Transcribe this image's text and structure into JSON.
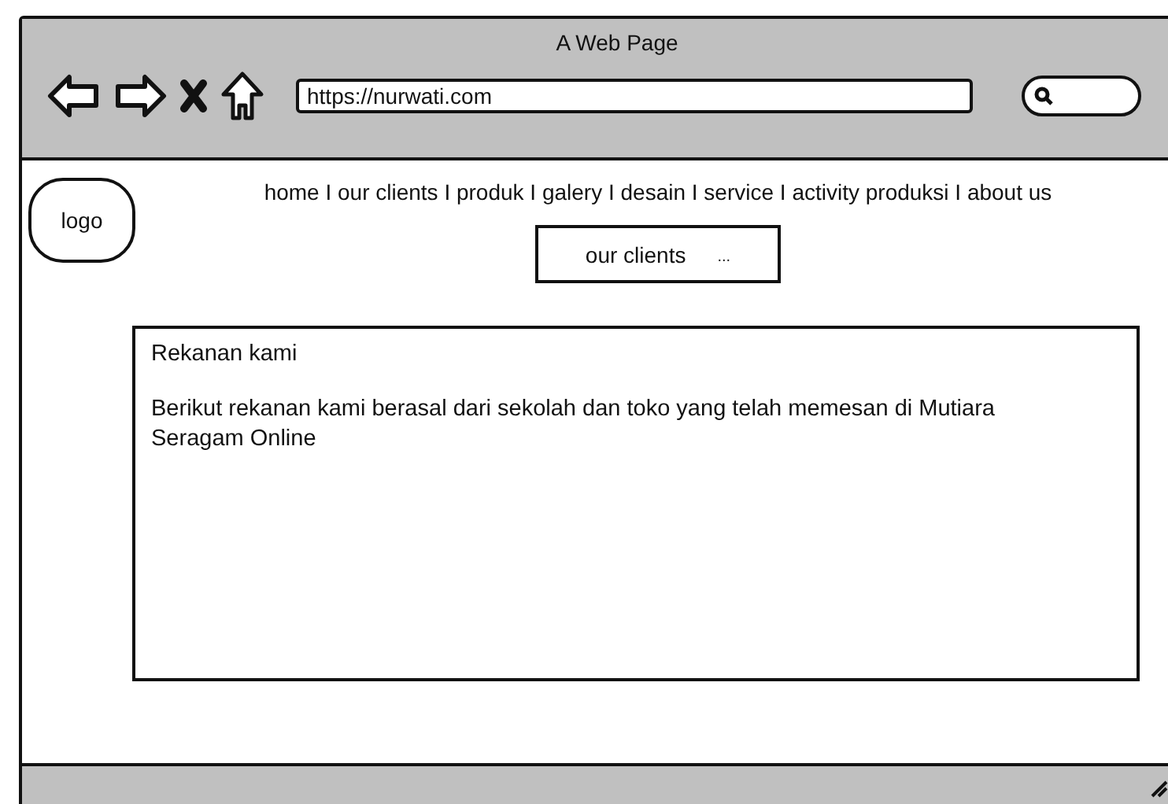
{
  "window": {
    "title": "A Web Page"
  },
  "address_bar": {
    "value": "https://nurwati.com"
  },
  "logo": {
    "label": "logo"
  },
  "nav": {
    "links": "home I our clients I produk I galery I desain I service I activity produksi I about us"
  },
  "section_button": {
    "label": "our clients",
    "more": "..."
  },
  "content": {
    "heading": "Rekanan kami",
    "body": "Berikut rekanan kami berasal dari sekolah dan toko yang telah memesan di Mutiara Seragam Online"
  }
}
